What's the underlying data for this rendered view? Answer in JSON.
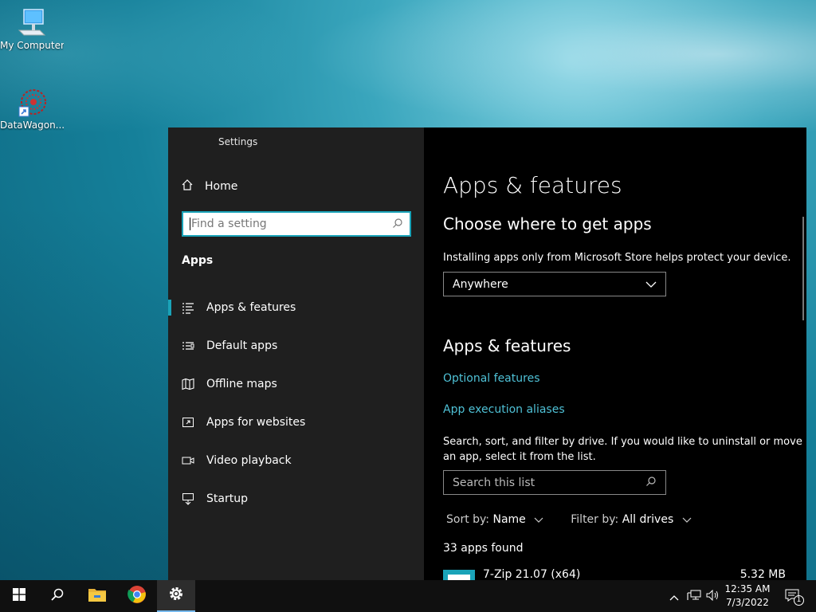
{
  "desktop": {
    "icons": [
      {
        "label": "My Computer",
        "icon": "computer-icon"
      },
      {
        "label": "DataWagon...",
        "icon": "datawagon-shortcut-icon"
      }
    ]
  },
  "settings": {
    "window_title": "Settings",
    "home_label": "Home",
    "search_placeholder": "Find a setting",
    "section_label": "Apps",
    "nav_items": [
      {
        "label": "Apps & features",
        "icon": "apps-list-icon",
        "active": true
      },
      {
        "label": "Default apps",
        "icon": "default-apps-icon",
        "active": false
      },
      {
        "label": "Offline maps",
        "icon": "map-icon",
        "active": false
      },
      {
        "label": "Apps for websites",
        "icon": "open-link-icon",
        "active": false
      },
      {
        "label": "Video playback",
        "icon": "video-icon",
        "active": false
      },
      {
        "label": "Startup",
        "icon": "startup-icon",
        "active": false
      }
    ],
    "content": {
      "page_title": "Apps & features",
      "choose_heading": "Choose where to get apps",
      "choose_desc": "Installing apps only from Microsoft Store helps protect your device.",
      "source_selected": "Anywhere",
      "features_heading": "Apps & features",
      "optional_features_link": "Optional features",
      "aliases_link": "App execution aliases",
      "search_desc_line1": "Search, sort, and filter by drive. If you would like to uninstall or move",
      "search_desc_line2": "an app, select it from the list.",
      "list_search_placeholder": "Search this list",
      "sort_label": "Sort by:",
      "sort_value": "Name",
      "filter_label": "Filter by:",
      "filter_value": "All drives",
      "apps_count": "33 apps found",
      "apps": [
        {
          "name": "7-Zip 21.07 (x64)",
          "size": "5.32 MB"
        }
      ]
    }
  },
  "taskbar": {
    "buttons": [
      "start-icon",
      "search-icon",
      "file-explorer-icon",
      "chrome-icon",
      "settings-gear-icon"
    ],
    "active_button": "settings-gear-icon",
    "time": "12:35 AM",
    "date": "7/3/2022",
    "notification_count": "1"
  },
  "colors": {
    "accent": "#1aa3b8",
    "link": "#4fc1d6",
    "nav_bg": "#1f1f1f",
    "content_bg": "#000000",
    "taskbar_bg": "#101010"
  }
}
